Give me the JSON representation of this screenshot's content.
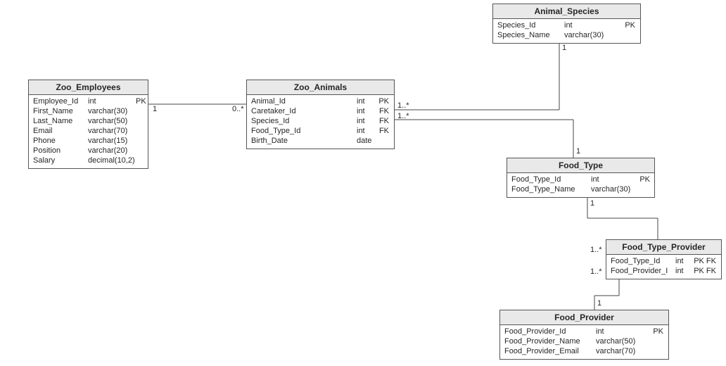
{
  "entities": {
    "zoo_employees": {
      "title": "Zoo_Employees",
      "cols": [
        {
          "name": "Employee_Id",
          "type": "int",
          "key": "PK"
        },
        {
          "name": "First_Name",
          "type": "varchar(30)",
          "key": ""
        },
        {
          "name": "Last_Name",
          "type": "varchar(50)",
          "key": ""
        },
        {
          "name": "Email",
          "type": "varchar(70)",
          "key": ""
        },
        {
          "name": "Phone",
          "type": "varchar(15)",
          "key": ""
        },
        {
          "name": "Position",
          "type": "varchar(20)",
          "key": ""
        },
        {
          "name": "Salary",
          "type": "decimal(10,2)",
          "key": ""
        }
      ]
    },
    "zoo_animals": {
      "title": "Zoo_Animals",
      "cols": [
        {
          "name": "Animal_Id",
          "type": "int",
          "key": "PK"
        },
        {
          "name": "Caretaker_Id",
          "type": "int",
          "key": "FK"
        },
        {
          "name": "Species_Id",
          "type": "int",
          "key": "FK"
        },
        {
          "name": "Food_Type_Id",
          "type": "int",
          "key": "FK"
        },
        {
          "name": "Birth_Date",
          "type": "date",
          "key": ""
        }
      ]
    },
    "animal_species": {
      "title": "Animal_Species",
      "cols": [
        {
          "name": "Species_Id",
          "type": "int",
          "key": "PK"
        },
        {
          "name": "Species_Name",
          "type": "varchar(30)",
          "key": ""
        }
      ]
    },
    "food_type": {
      "title": "Food_Type",
      "cols": [
        {
          "name": "Food_Type_Id",
          "type": "int",
          "key": "PK"
        },
        {
          "name": "Food_Type_Name",
          "type": "varchar(30)",
          "key": ""
        }
      ]
    },
    "food_type_provider": {
      "title": "Food_Type_Provider",
      "cols": [
        {
          "name": "Food_Type_Id",
          "type": "int",
          "key": "PK FK"
        },
        {
          "name": "Food_Provider_I",
          "type": "int",
          "key": "PK FK"
        }
      ]
    },
    "food_provider": {
      "title": "Food_Provider",
      "cols": [
        {
          "name": "Food_Provider_Id",
          "type": "int",
          "key": "PK"
        },
        {
          "name": "Food_Provider_Name",
          "type": "varchar(50)",
          "key": ""
        },
        {
          "name": "Food_Provider_Email",
          "type": "varchar(70)",
          "key": ""
        }
      ]
    }
  },
  "multiplicities": {
    "emp_anim_left": "1",
    "emp_anim_right": "0..*",
    "anim_spec_left": "1..*",
    "anim_spec_right": "1",
    "anim_food_left": "1..*",
    "anim_food_right": "1",
    "food_ftp_left": "1",
    "food_ftp_right": "1..*",
    "prov_ftp_left": "1",
    "prov_ftp_right": "1..*"
  }
}
